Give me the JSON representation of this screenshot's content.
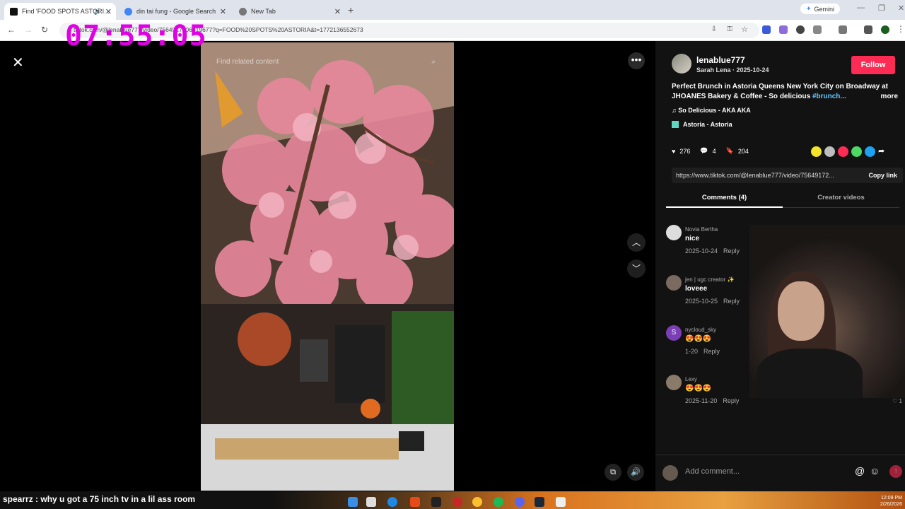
{
  "browser": {
    "tabs": [
      {
        "label": "Find 'FOOD SPOTS ASTORI...",
        "active": true,
        "favicon_color": "#111111"
      },
      {
        "label": "din tai fung - Google Search",
        "active": false,
        "favicon_color": "#4285f4"
      },
      {
        "label": "New Tab",
        "active": false,
        "favicon_color": "#555555"
      }
    ],
    "new_tab": "+",
    "gemini_label": "Gemini",
    "url": "tiktok.com/@lenablue777/video/7564917206319677?q=FOOD%20SPOTS%20ASTORIA&t=1772136552673"
  },
  "overlay_timer": "07:55:05",
  "video": {
    "search_placeholder": "Find related content"
  },
  "post": {
    "username": "lenablue777",
    "display_name_date": "Sarah Lena · 2025-10-24",
    "follow_label": "Follow",
    "description": "Perfect Brunch in Astoria Queens New York City on Broadway at JHOANES Bakery & Coffee - So delicious ",
    "hashtag": "#brunch...",
    "more_label": "more",
    "music": "So Delicious - AKA AKA",
    "location": "Astoria - Astoria",
    "likes": "276",
    "comments": "4",
    "saves": "204",
    "link": "https://www.tiktok.com/@lenablue777/video/75649172...",
    "copy_link": "Copy link",
    "tab_comments": "Comments (4)",
    "tab_creator": "Creator videos",
    "share_colors": [
      "#f5e52a",
      "#bdbdbd",
      "#fe2c55",
      "#4cd964",
      "#1da1f2"
    ]
  },
  "comments": [
    {
      "name": "Novia Bertha",
      "text": "nice",
      "date": "2025-10-24",
      "reply": "Reply",
      "avatar_color": "#dddddd"
    },
    {
      "name": "jen | ugc creator ✨",
      "text": "loveee",
      "date": "2025-10-25",
      "reply": "Reply",
      "avatar_color": "#7a6a60"
    },
    {
      "name": "nycloud_sky",
      "text": "😍😍😍",
      "date": "1-20",
      "reply": "Reply",
      "avatar_color": "#7b3fb5",
      "initial": "S"
    },
    {
      "name": "Lexy",
      "text": "😍😍😍",
      "date": "2025-11-20",
      "reply": "Reply",
      "avatar_color": "#8a7a6a"
    }
  ],
  "comment_like_count": "♡ 1",
  "add_comment_placeholder": "Add comment...",
  "chat": {
    "message": "spearrz : why u got a 75 inch tv in a lil ass room"
  },
  "clock": {
    "time": "12:09 PM",
    "date": "2/26/2026"
  }
}
